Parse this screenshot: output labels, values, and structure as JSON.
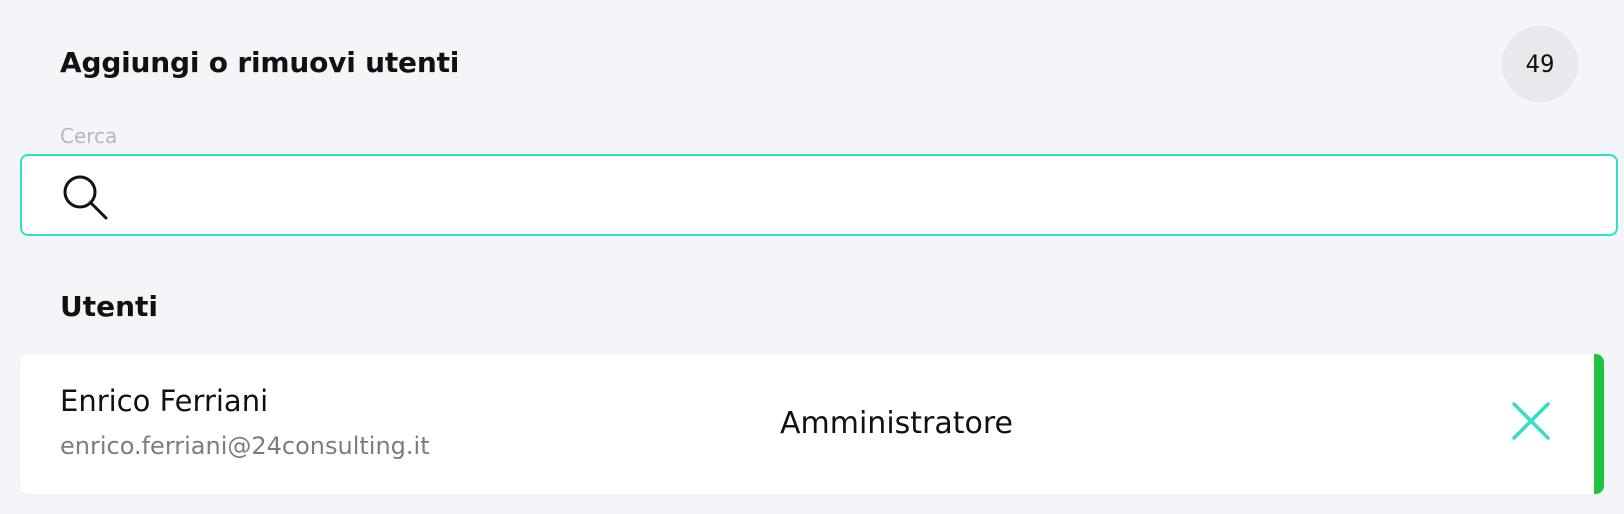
{
  "header": {
    "title": "Aggiungi o rimuovi utenti",
    "count": "49"
  },
  "search": {
    "label": "Cerca",
    "value": "",
    "placeholder": "",
    "icon": "search-icon",
    "border_color": "#2fe0c5"
  },
  "users_section": {
    "title": "Utenti",
    "items": [
      {
        "name": "Enrico Ferriani",
        "email": "enrico.ferriani@24consulting.it",
        "role": "Amministratore",
        "remove_icon": "close-icon",
        "accent_color": "#1fc241"
      }
    ]
  },
  "colors": {
    "background": "#f4f5f9",
    "accent": "#2fe0c5",
    "status_bar": "#1fc241"
  }
}
